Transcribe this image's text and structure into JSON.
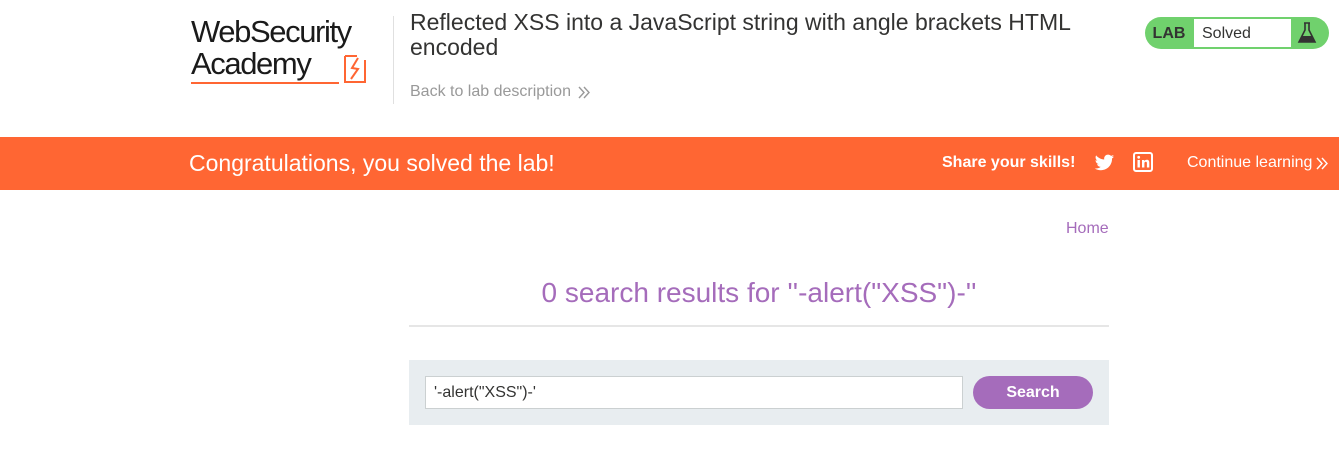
{
  "header": {
    "logo": {
      "line1": "WebSecurity",
      "line2": "Academy"
    },
    "lab_title": "Reflected XSS into a JavaScript string with angle brackets HTML encoded",
    "back_link": "Back to lab description"
  },
  "status": {
    "tag": "LAB",
    "value": "Solved",
    "icon": "flask-icon",
    "color": "#70d16d"
  },
  "banner": {
    "message": "Congratulations, you solved the lab!",
    "share_label": "Share your skills!",
    "share_icons": [
      "twitter-icon",
      "linkedin-icon"
    ],
    "continue_link": "Continue learning",
    "color": "#ff6633"
  },
  "nav": {
    "home": "Home"
  },
  "results": {
    "heading": "0 search results for ''-alert(\"XSS\")-''"
  },
  "search": {
    "value": "'-alert(\"XSS\")-'",
    "button_label": "Search",
    "accent": "#a56cbb"
  }
}
